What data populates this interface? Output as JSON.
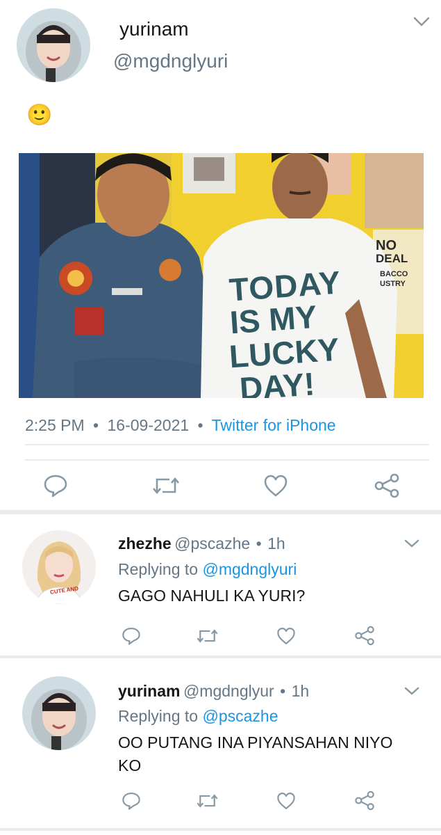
{
  "main_tweet": {
    "display_name": "yurinam",
    "handle": "@mgdnglyuri",
    "text": "🙂",
    "photo": {
      "shirt_line1": "TODAY",
      "shirt_line2": "IS MY",
      "shirt_line3": "LUCKY",
      "shirt_line4": "DAY!",
      "sign_line1": "NO",
      "sign_line2": "DEAL",
      "sign_line3": "BACCO",
      "sign_line4": "USTRY"
    },
    "time": "2:25 PM",
    "date": "16-09-2021",
    "source": "Twitter for iPhone",
    "separator": "•"
  },
  "replies": [
    {
      "display_name": "zhezhe",
      "handle": "@pscazhe",
      "age": "1h",
      "replying_prefix": "Replying to",
      "replying_to": "@mgdnglyuri",
      "text": "GAGO NAHULI KA YURI?",
      "avatar_shirt_text": "CUTE AND"
    },
    {
      "display_name": "yurinam",
      "handle": "@mgdnglyur",
      "age": "1h",
      "replying_prefix": "Replying to",
      "replying_to": "@pscazhe",
      "text_line1": "OO PUTANG INA PIYANSAHAN NIYO",
      "text_line2": "KO"
    }
  ],
  "icons": [
    "chevron-down-icon",
    "reply-icon",
    "retweet-icon",
    "like-icon",
    "share-icon"
  ],
  "colors": {
    "link": "#1b95e0",
    "secondary": "#657786",
    "icon": "#8899a6",
    "divider": "#e6ecf0"
  }
}
